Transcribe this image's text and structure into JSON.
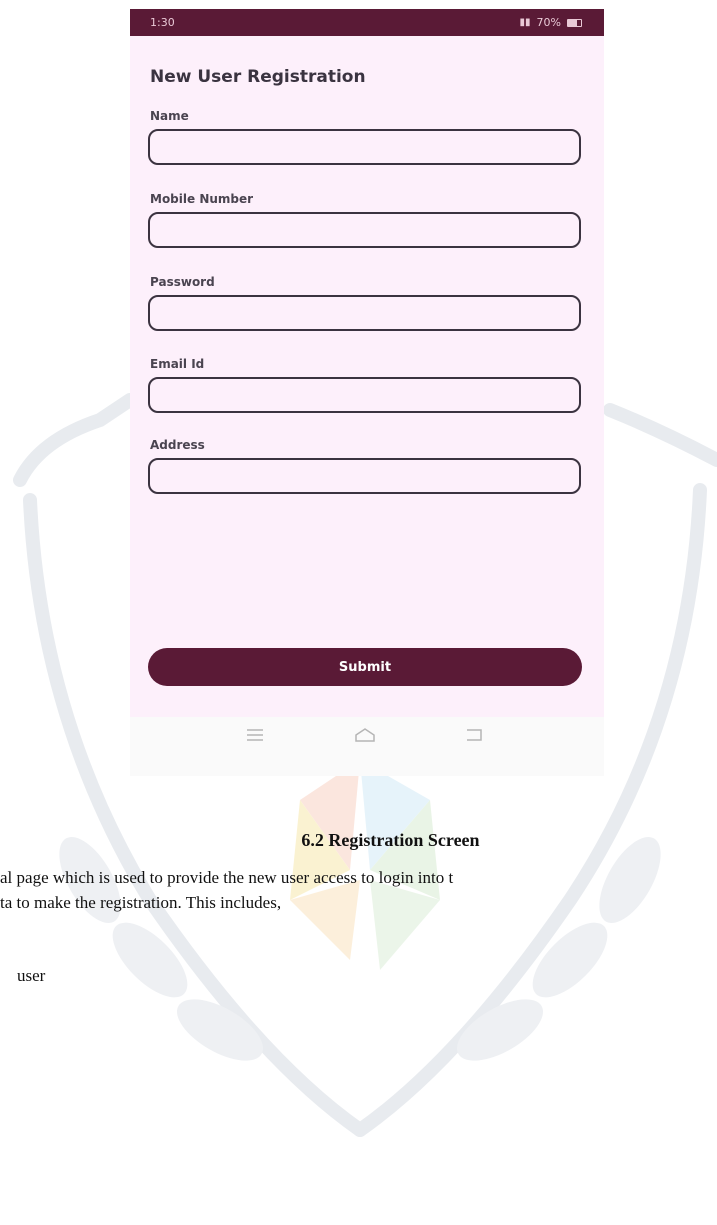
{
  "phone": {
    "status_bar": {
      "time": "1:30",
      "battery": "70%"
    },
    "form": {
      "title": "New User Registration",
      "fields": [
        {
          "label": "Name",
          "value": ""
        },
        {
          "label": "Mobile Number",
          "value": ""
        },
        {
          "label": "Password",
          "value": ""
        },
        {
          "label": "Email Id",
          "value": ""
        },
        {
          "label": "Address",
          "value": ""
        }
      ],
      "submit_label": "Submit"
    },
    "nav_bar": {
      "icons": [
        "menu-icon",
        "home-icon",
        "back-icon"
      ]
    }
  },
  "document": {
    "caption": "6.2 Registration Screen",
    "line1": "al page which is used to provide the new user access to login into t",
    "line2": "ta to make the registration. This includes,",
    "line3": "user"
  },
  "colors": {
    "accent": "#5a1a36",
    "screen_background": "#fdf0fb",
    "input_border": "#3b3340"
  }
}
